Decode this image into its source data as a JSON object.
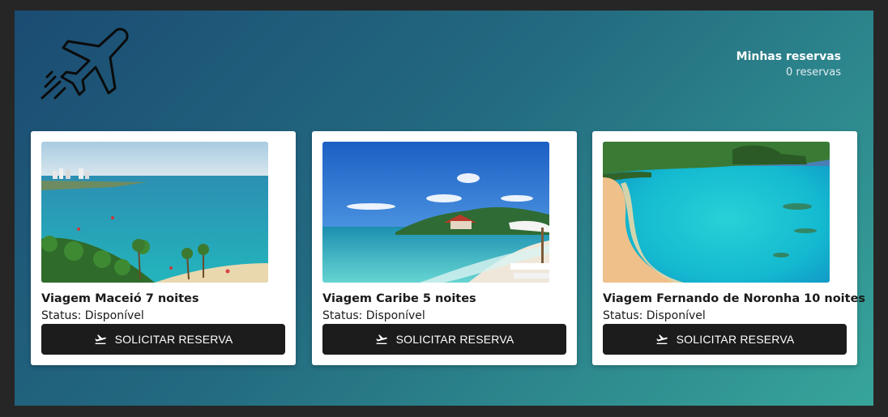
{
  "header": {
    "logo_icon": "airplane-icon",
    "reservations_title": "Minhas reservas",
    "reservations_count": "0 reservas"
  },
  "trips": [
    {
      "name": "Viagem Maceió 7 noites",
      "status": "Status: Disponível",
      "button_label": "SOLICITAR RESERVA",
      "button_icon": "flight-takeoff-icon"
    },
    {
      "name": "Viagem Caribe 5 noites",
      "status": "Status: Disponível",
      "button_label": "SOLICITAR RESERVA",
      "button_icon": "flight-takeoff-icon"
    },
    {
      "name": "Viagem Fernando de Noronha 10 noites",
      "status": "Status: Disponível",
      "button_label": "SOLICITAR RESERVA",
      "button_icon": "flight-takeoff-icon"
    }
  ],
  "colors": {
    "gradient_start": "#1b4c73",
    "gradient_end": "#37a59a",
    "button": "#1c1c1c"
  }
}
